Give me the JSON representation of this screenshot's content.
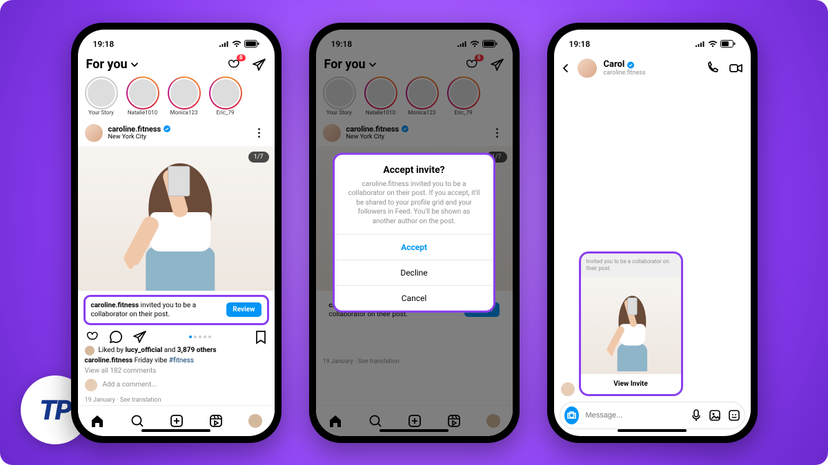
{
  "brand": {
    "logo_text": "TP"
  },
  "status": {
    "time": "19:18"
  },
  "feed": {
    "header_title": "For you",
    "notif_badge": "8",
    "stories": [
      {
        "label": "Your Story",
        "self": true
      },
      {
        "label": "Natalie1010"
      },
      {
        "label": "Monica123"
      },
      {
        "label": "Eric_79"
      }
    ],
    "post": {
      "username": "caroline.fitness",
      "location": "New York City",
      "counter": "1/7",
      "invite_text_user": "caroline.fitness",
      "invite_text_rest": " invited you to be a collaborator on their post.",
      "review_label": "Review",
      "liked_by_user": "lucy_official",
      "liked_by_count": "3,879 others",
      "liked_prefix": "Liked by ",
      "liked_and": " and ",
      "caption_text": "Friday vibe ",
      "hashtag": "#fitness",
      "view_comments": "View all 182 comments",
      "add_comment": "Add a comment...",
      "date": "19 January",
      "see_translation": "See translation"
    }
  },
  "dialog": {
    "title": "Accept invite?",
    "body": "caroline.fitness invited you to be a collaborator on their post. If you accept, it'll be shared to your profile grid and your followers in Feed. You'll be shown as another author on the post.",
    "accept": "Accept",
    "decline": "Decline",
    "cancel": "Cancel"
  },
  "dm": {
    "name": "Carol",
    "handle": "caroline.fitness",
    "collab_text": "Invited you to be a collaborator on their post.",
    "view_invite": "View Invite",
    "composer_placeholder": "Message..."
  }
}
